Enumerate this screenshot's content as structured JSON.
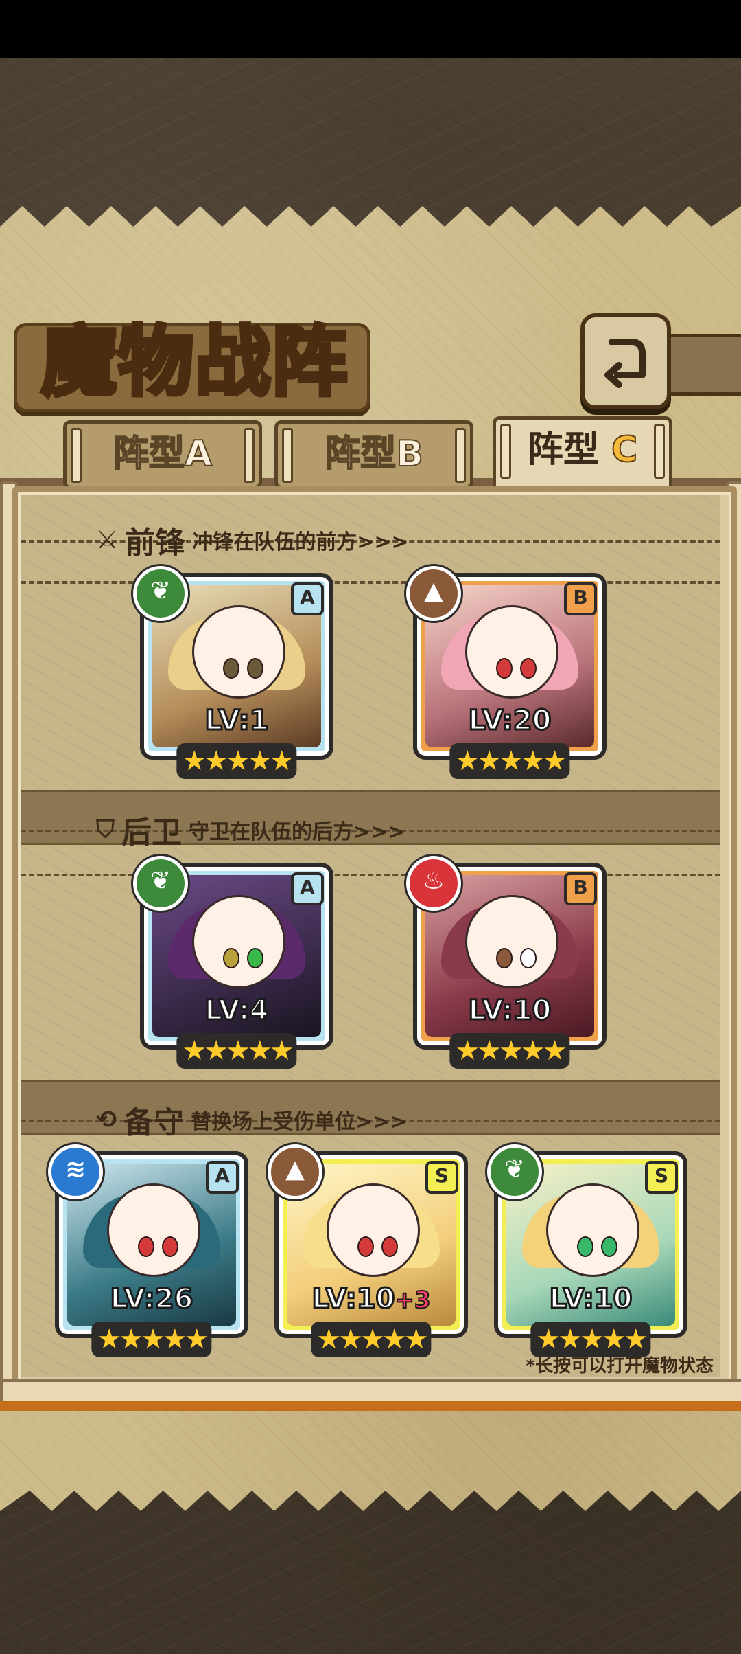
{
  "title": "魔物战阵",
  "tabs": [
    {
      "name": "阵型",
      "letter": "A",
      "active": false
    },
    {
      "name": "阵型",
      "letter": "B",
      "active": false
    },
    {
      "name": "阵型",
      "letter": "C",
      "active": true
    }
  ],
  "sections": [
    {
      "icon": "sword-icon",
      "icon_glyph": "⚔",
      "title": "前锋",
      "desc": "冲锋在队伍的前方>>>"
    },
    {
      "icon": "shield-icon",
      "icon_glyph": "⛉",
      "title": "后卫",
      "desc": "守卫在队伍的后方>>>"
    },
    {
      "icon": "swap-icon",
      "icon_glyph": "⟲",
      "title": "备守",
      "desc": "替换场上受伤单位>>>"
    }
  ],
  "cards": [
    {
      "slot": "front-1",
      "grade": "A",
      "element": "nature",
      "element_glyph": "❦",
      "level": "LV:1",
      "bonus": "",
      "stars": "★★★★★"
    },
    {
      "slot": "front-2",
      "grade": "B",
      "element": "earth",
      "element_glyph": "▲",
      "level": "LV:20",
      "bonus": "",
      "stars": "★★★★★"
    },
    {
      "slot": "back-1",
      "grade": "A",
      "element": "nature",
      "element_glyph": "❦",
      "level": "LV:4",
      "bonus": "",
      "stars": "★★★★★"
    },
    {
      "slot": "back-2",
      "grade": "B",
      "element": "fire",
      "element_glyph": "♨",
      "level": "LV:10",
      "bonus": "",
      "stars": "★★★★★"
    },
    {
      "slot": "reserve-1",
      "grade": "A",
      "element": "water",
      "element_glyph": "≋",
      "level": "LV:26",
      "bonus": "",
      "stars": "★★★★★"
    },
    {
      "slot": "reserve-2",
      "grade": "S",
      "element": "earth",
      "element_glyph": "▲",
      "level": "LV:10",
      "bonus": "+3",
      "stars": "★★★★★"
    },
    {
      "slot": "reserve-3",
      "grade": "S",
      "element": "nature",
      "element_glyph": "❦",
      "level": "LV:10",
      "bonus": "",
      "stars": "★★★★★"
    }
  ],
  "hint": "*长按可以打开魔物状态",
  "back_icon": "back-arrow-icon"
}
